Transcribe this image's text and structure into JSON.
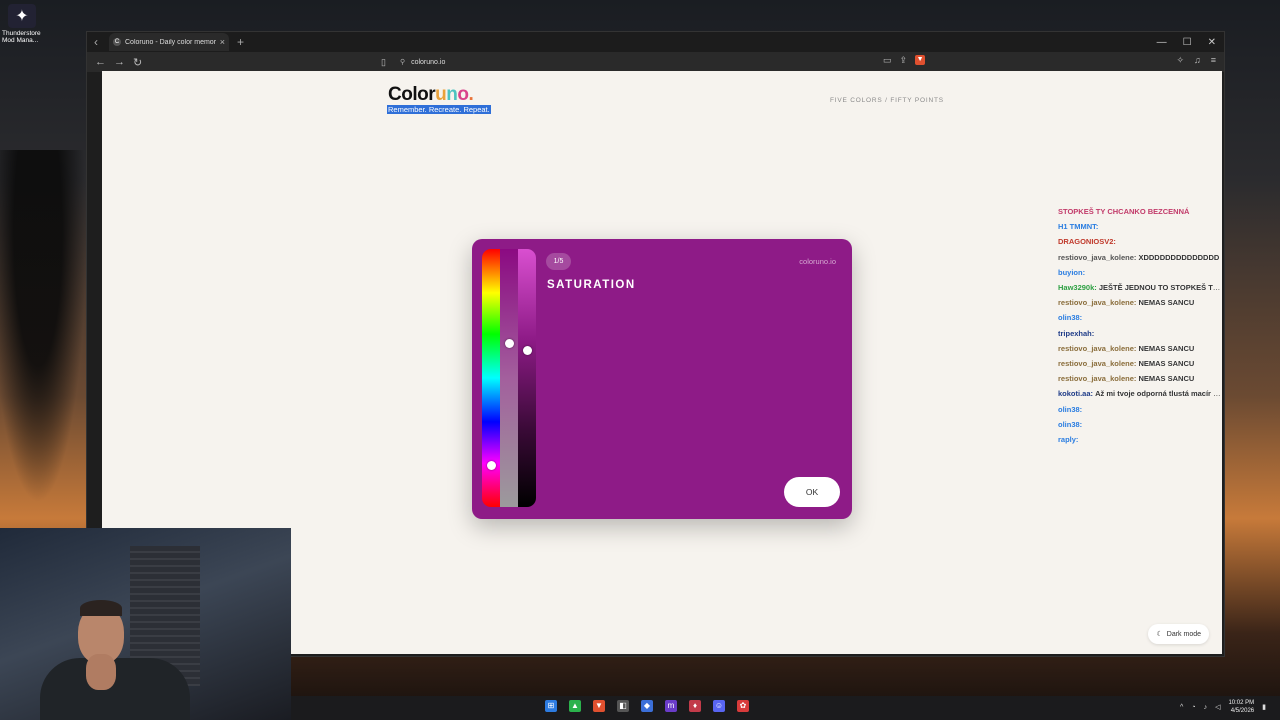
{
  "desktop": {
    "icon_label": "Thunderstore Mod Mana..."
  },
  "browser": {
    "tab_title": "Coloruno - Daily color memory g",
    "url": "coloruno.io"
  },
  "site": {
    "logo_prefix": "Color",
    "logo_parts": [
      "u",
      "n",
      "o"
    ],
    "logo_dot": ".",
    "tagline": "Remember. Recreate. Repeat.",
    "nav_text": "FIVE COLORS / FIFTY POINTS",
    "dark_mode_label": "Dark mode"
  },
  "card": {
    "step": "1/5",
    "title": "SATURATION",
    "brand": "coloruno.io",
    "ok_label": "OK",
    "color": "#8e1b87"
  },
  "chat": [
    {
      "user": "STOPKEŠ TY CHCANKO BEZCENNÁ",
      "msg": ""
    },
    {
      "user": "H1 TMMNT:",
      "msg": ""
    },
    {
      "user": "DRAGONIOSV2:",
      "msg": ""
    },
    {
      "user": "restiovo_java_kolene:",
      "msg": "XDDDDDDDDDDDDDD"
    },
    {
      "user": "buyion:",
      "msg": ""
    },
    {
      "user": "Haw3290k:",
      "msg": "JEŠTĚ JEDNOU TO STOPKEŠ TY CHCANKO BEZCENNÁ"
    },
    {
      "user": "restiovo_java_kolene:",
      "msg": "NEMAS SANCU"
    },
    {
      "user": "olin38:",
      "msg": ""
    },
    {
      "user": "tripexhah:",
      "msg": ""
    },
    {
      "user": "restiovo_java_kolene:",
      "msg": "NEMAS SANCU"
    },
    {
      "user": "restiovo_java_kolene:",
      "msg": "NEMAS SANCU"
    },
    {
      "user": "restiovo_java_kolene:",
      "msg": "NEMAS SANCU"
    },
    {
      "user": "kokoti.aa:",
      "msg": "Až mi tvoje odporná tlustá macír ukládí koupelnu tak si od ní nechám ohlídat endlik jen tak"
    },
    {
      "user": "olin38:",
      "msg": ""
    },
    {
      "user": "olin38:",
      "msg": ""
    },
    {
      "user": "raply:",
      "msg": ""
    }
  ],
  "taskbar": {
    "time": "10:02 PM",
    "date": "4/5/2026"
  },
  "picker": {
    "hue_level": 0.85,
    "saturation_level": 0.36,
    "lightness_level": 0.39
  }
}
